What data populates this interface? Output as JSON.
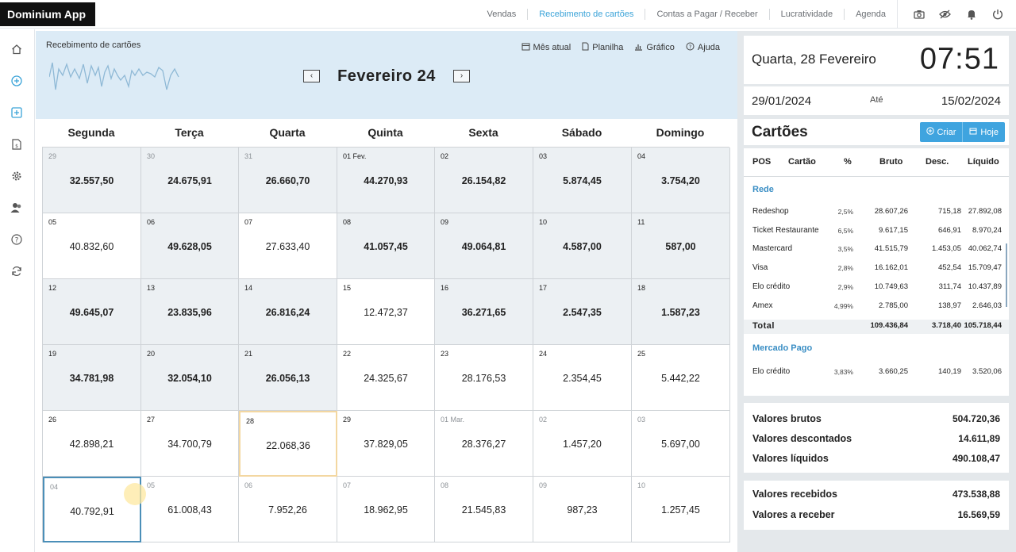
{
  "app": {
    "brand": "Dominium App"
  },
  "nav": {
    "links": [
      "Vendas",
      "Recebimento de cartões",
      "Contas a Pagar / Receber",
      "Lucratividade",
      "Agenda"
    ],
    "active_index": 1,
    "icons": [
      "camera-icon",
      "eye-off-icon",
      "bell-icon",
      "power-icon"
    ]
  },
  "sidebar": {
    "icons": [
      "home-icon",
      "plus-circle-icon",
      "plus-square-icon",
      "document-icon",
      "gear-icon",
      "users-icon",
      "help-icon",
      "refresh-icon"
    ]
  },
  "header": {
    "title": "Recebimento de cartões",
    "links": [
      {
        "icon": "calendar-icon",
        "label": "Mês atual"
      },
      {
        "icon": "file-icon",
        "label": "Planilha"
      },
      {
        "icon": "chart-icon",
        "label": "Gráfico"
      },
      {
        "icon": "help-icon",
        "label": "Ajuda"
      }
    ],
    "month": "Fevereiro 24",
    "prev_label": "‹",
    "next_label": "›"
  },
  "calendar": {
    "weekdays": [
      "Segunda",
      "Terça",
      "Quarta",
      "Quinta",
      "Sexta",
      "Sábado",
      "Domingo"
    ],
    "days": [
      {
        "day": "29",
        "amount": "32.557,50",
        "out": true,
        "shaded": true,
        "bold": true
      },
      {
        "day": "30",
        "amount": "24.675,91",
        "out": true,
        "shaded": true,
        "bold": true
      },
      {
        "day": "31",
        "amount": "26.660,70",
        "out": true,
        "shaded": true,
        "bold": true
      },
      {
        "day": "01 Fev.",
        "amount": "44.270,93",
        "shaded": true,
        "bold": true
      },
      {
        "day": "02",
        "amount": "26.154,82",
        "shaded": true,
        "bold": true
      },
      {
        "day": "03",
        "amount": "5.874,45",
        "shaded": true,
        "bold": true
      },
      {
        "day": "04",
        "amount": "3.754,20",
        "shaded": true,
        "bold": true
      },
      {
        "day": "05",
        "amount": "40.832,60"
      },
      {
        "day": "06",
        "amount": "49.628,05",
        "shaded": true,
        "bold": true
      },
      {
        "day": "07",
        "amount": "27.633,40"
      },
      {
        "day": "08",
        "amount": "41.057,45",
        "shaded": true,
        "bold": true
      },
      {
        "day": "09",
        "amount": "49.064,81",
        "shaded": true,
        "bold": true
      },
      {
        "day": "10",
        "amount": "4.587,00",
        "shaded": true,
        "bold": true
      },
      {
        "day": "11",
        "amount": "587,00",
        "shaded": true,
        "bold": true
      },
      {
        "day": "12",
        "amount": "49.645,07",
        "shaded": true,
        "bold": true
      },
      {
        "day": "13",
        "amount": "23.835,96",
        "shaded": true,
        "bold": true
      },
      {
        "day": "14",
        "amount": "26.816,24",
        "shaded": true,
        "bold": true
      },
      {
        "day": "15",
        "amount": "12.472,37"
      },
      {
        "day": "16",
        "amount": "36.271,65",
        "shaded": true,
        "bold": true
      },
      {
        "day": "17",
        "amount": "2.547,35",
        "shaded": true,
        "bold": true
      },
      {
        "day": "18",
        "amount": "1.587,23",
        "shaded": true,
        "bold": true
      },
      {
        "day": "19",
        "amount": "34.781,98",
        "shaded": true,
        "bold": true
      },
      {
        "day": "20",
        "amount": "32.054,10",
        "shaded": true,
        "bold": true
      },
      {
        "day": "21",
        "amount": "26.056,13",
        "shaded": true,
        "bold": true
      },
      {
        "day": "22",
        "amount": "24.325,67"
      },
      {
        "day": "23",
        "amount": "28.176,53"
      },
      {
        "day": "24",
        "amount": "2.354,45"
      },
      {
        "day": "25",
        "amount": "5.442,22"
      },
      {
        "day": "26",
        "amount": "42.898,21"
      },
      {
        "day": "27",
        "amount": "34.700,79"
      },
      {
        "day": "28",
        "amount": "22.068,36",
        "today": true
      },
      {
        "day": "29",
        "amount": "37.829,05"
      },
      {
        "day": "01 Mar.",
        "amount": "28.376,27",
        "out": true
      },
      {
        "day": "02",
        "amount": "1.457,20",
        "out": true
      },
      {
        "day": "03",
        "amount": "5.697,00",
        "out": true
      },
      {
        "day": "04",
        "amount": "40.792,91",
        "out": true,
        "selected": true
      },
      {
        "day": "05",
        "amount": "61.008,43",
        "out": true
      },
      {
        "day": "06",
        "amount": "7.952,26",
        "out": true
      },
      {
        "day": "07",
        "amount": "18.962,95",
        "out": true
      },
      {
        "day": "08",
        "amount": "21.545,83",
        "out": true
      },
      {
        "day": "09",
        "amount": "987,23",
        "out": true
      },
      {
        "day": "10",
        "amount": "1.257,45",
        "out": true
      }
    ]
  },
  "clock": {
    "date": "Quarta, 28 Fevereiro",
    "time": "07:51"
  },
  "range": {
    "from": "29/01/2024",
    "label": "Até",
    "to": "15/02/2024"
  },
  "cards": {
    "title": "Cartões",
    "create_label": "Criar",
    "today_label": "Hoje",
    "columns": [
      "POS",
      "Cartão",
      "%",
      "Bruto",
      "Desc.",
      "Líquido"
    ],
    "groups": [
      {
        "name": "Rede",
        "rows": [
          {
            "name": "Redeshop",
            "pct": "2,5%",
            "gross": "28.607,26",
            "disc": "715,18",
            "net": "27.892,08"
          },
          {
            "name": "Ticket Restaurante",
            "pct": "6,5%",
            "gross": "9.617,15",
            "disc": "646,91",
            "net": "8.970,24"
          },
          {
            "name": "Mastercard",
            "pct": "3,5%",
            "gross": "41.515,79",
            "disc": "1.453,05",
            "net": "40.062,74"
          },
          {
            "name": "Visa",
            "pct": "2,8%",
            "gross": "16.162,01",
            "disc": "452,54",
            "net": "15.709,47"
          },
          {
            "name": "Elo crédito",
            "pct": "2,9%",
            "gross": "10.749,63",
            "disc": "311,74",
            "net": "10.437,89"
          },
          {
            "name": "Amex",
            "pct": "4,99%",
            "gross": "2.785,00",
            "disc": "138,97",
            "net": "2.646,03"
          }
        ],
        "total": {
          "label": "Total",
          "gross": "109.436,84",
          "disc": "3.718,40",
          "net": "105.718,44"
        }
      },
      {
        "name": "Mercado Pago",
        "rows": [
          {
            "name": "Elo crédito",
            "pct": "3,83%",
            "gross": "3.660,25",
            "disc": "140,19",
            "net": "3.520,06"
          }
        ]
      }
    ]
  },
  "summary": {
    "gross_label": "Valores brutos",
    "gross": "504.720,36",
    "disc_label": "Valores descontados",
    "disc": "14.611,89",
    "net_label": "Valores líquidos",
    "net": "490.108,47",
    "received_label": "Valores recebidos",
    "received": "473.538,88",
    "receivable_label": "Valores a receber",
    "receivable": "16.569,59"
  },
  "colors": {
    "accent": "#3aa3d8",
    "header_bg": "#dcebf6",
    "today_border": "#f3d7a1",
    "selected_border": "#4b8fb8"
  }
}
